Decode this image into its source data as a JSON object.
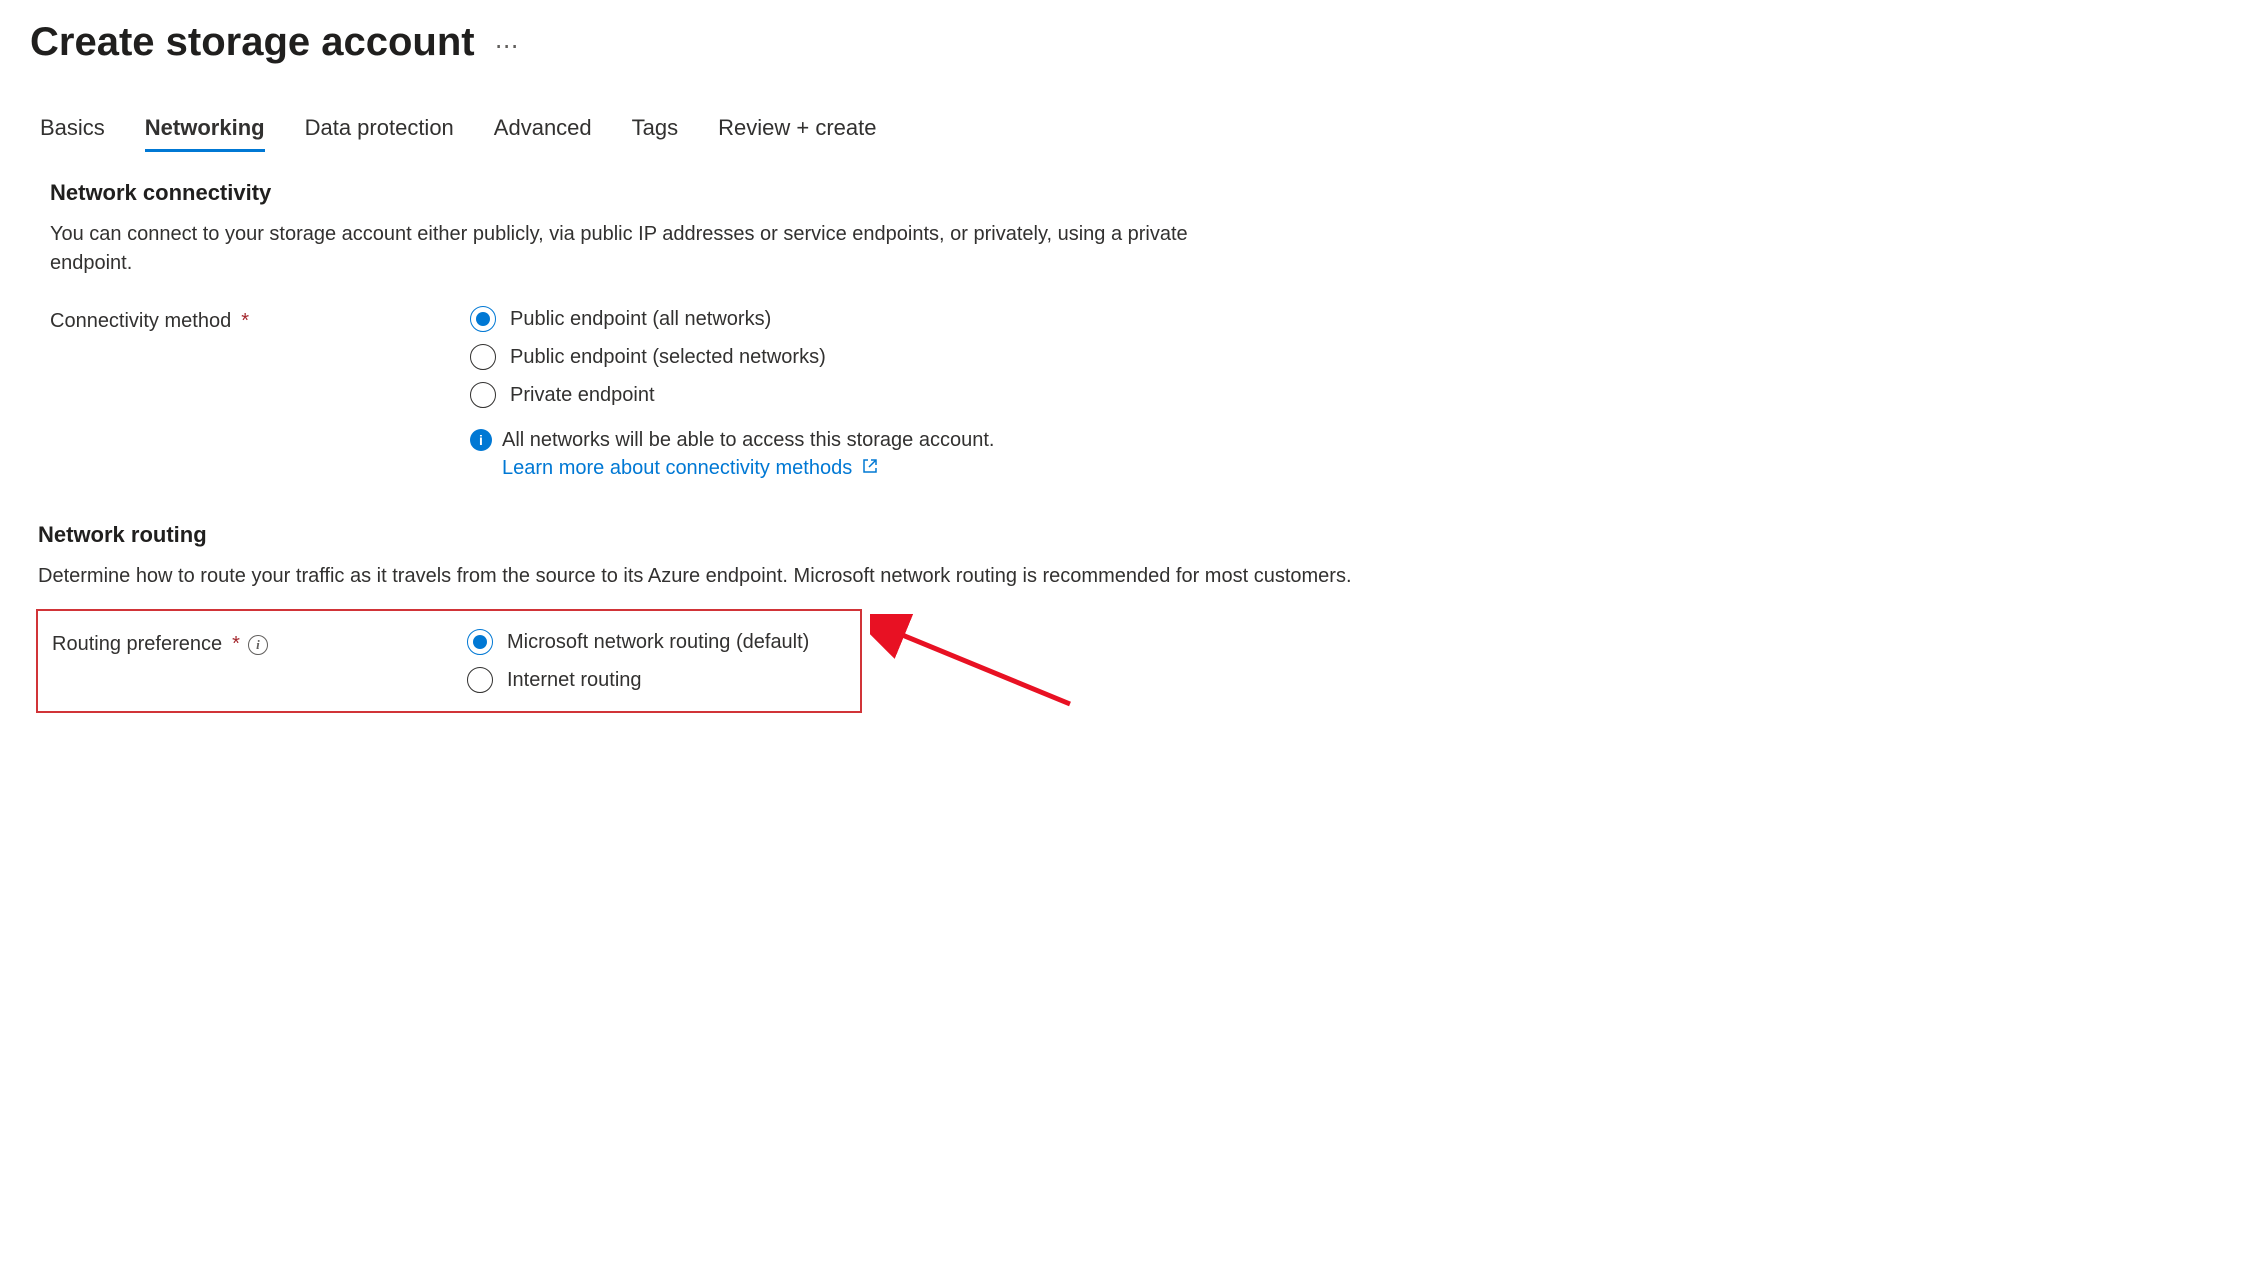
{
  "header": {
    "title": "Create storage account"
  },
  "tabs": [
    {
      "label": "Basics",
      "active": false
    },
    {
      "label": "Networking",
      "active": true
    },
    {
      "label": "Data protection",
      "active": false
    },
    {
      "label": "Advanced",
      "active": false
    },
    {
      "label": "Tags",
      "active": false
    },
    {
      "label": "Review + create",
      "active": false
    }
  ],
  "connectivity": {
    "title": "Network connectivity",
    "description": "You can connect to your storage account either publicly, via public IP addresses or service endpoints, or privately, using a private endpoint.",
    "label": "Connectivity method",
    "options": [
      {
        "label": "Public endpoint (all networks)",
        "selected": true
      },
      {
        "label": "Public endpoint (selected networks)",
        "selected": false
      },
      {
        "label": "Private endpoint",
        "selected": false
      }
    ],
    "info_text": "All networks will be able to access this storage account.",
    "info_link": "Learn more about connectivity methods"
  },
  "routing": {
    "title": "Network routing",
    "description": "Determine how to route your traffic as it travels from the source to its Azure endpoint. Microsoft network routing is recommended for most customers.",
    "label": "Routing preference",
    "options": [
      {
        "label": "Microsoft network routing (default)",
        "selected": true
      },
      {
        "label": "Internet routing",
        "selected": false
      }
    ]
  }
}
